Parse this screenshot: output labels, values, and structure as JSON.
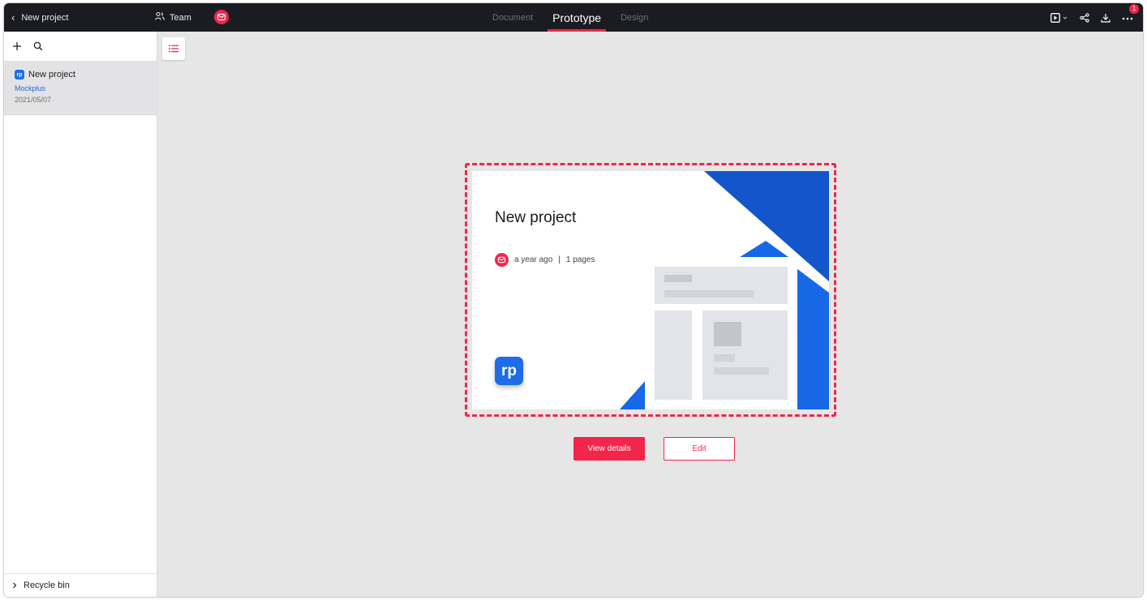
{
  "header": {
    "back_label": "New project",
    "team_label": "Team",
    "modes": [
      {
        "label": "Document",
        "active": false
      },
      {
        "label": "Prototype",
        "active": true
      },
      {
        "label": "Design",
        "active": false
      }
    ],
    "notification_count": "1"
  },
  "sidebar": {
    "project": {
      "name": "New project",
      "team": "Mockplus",
      "date": "2021/05/07",
      "badge": "rp"
    },
    "recycle_label": "Recycle bin"
  },
  "main": {
    "card": {
      "title": "New project",
      "updated": "a year ago",
      "separator": "|",
      "pages": "1 pages",
      "logo_text": "rp"
    },
    "buttons": {
      "view_details": "View details",
      "edit": "Edit"
    }
  },
  "colors": {
    "accent": "#f2254a",
    "brand_blue": "#1d6dea",
    "topbar": "#1b1c21"
  }
}
